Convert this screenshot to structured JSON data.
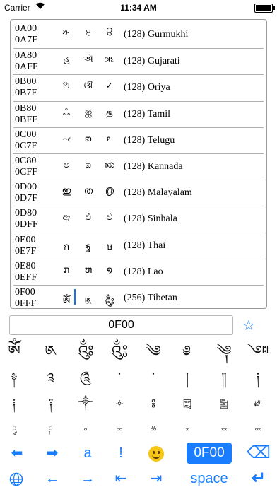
{
  "status_bar": {
    "carrier": "Carrier",
    "time": "11:34 AM"
  },
  "blocks": [
    {
      "start": "0A00",
      "end": "0A7F",
      "glyphs": [
        "ਅ",
        "ੲ",
        "ੳ"
      ],
      "count": "(128)",
      "name": "Gurmukhi"
    },
    {
      "start": "0A80",
      "end": "0AFF",
      "glyphs": [
        "હ",
        "ઍ",
        "ૠ"
      ],
      "count": "(128)",
      "name": "Gujarati"
    },
    {
      "start": "0B00",
      "end": "0B7F",
      "glyphs": [
        "ଅ",
        "ଔ",
        "✓"
      ],
      "count": "(128)",
      "name": "Oriya"
    },
    {
      "start": "0B80",
      "end": "0BFF",
      "glyphs": [
        "ஃ",
        "ஐ",
        "௲"
      ],
      "count": "(128)",
      "name": "Tamil"
    },
    {
      "start": "0C00",
      "end": "0C7F",
      "glyphs": [
        "ఁ",
        "ఐ",
        "ఽ"
      ],
      "count": "(128)",
      "name": "Telugu"
    },
    {
      "start": "0C80",
      "end": "0CFF",
      "glyphs": [
        "ಅ",
        "ಐ",
        "ಋ"
      ],
      "count": "(128)",
      "name": "Kannada"
    },
    {
      "start": "0D00",
      "end": "0D7F",
      "glyphs": [
        "ഇ",
        "ത",
        "൫"
      ],
      "count": "(128)",
      "name": "Malayalam"
    },
    {
      "start": "0D80",
      "end": "0DFF",
      "glyphs": [
        "ඇ",
        "ඵ",
        "ළු"
      ],
      "count": "(128)",
      "name": "Sinhala"
    },
    {
      "start": "0E00",
      "end": "0E7F",
      "glyphs": [
        "ก",
        "ฐ",
        "ษ"
      ],
      "count": "(128)",
      "name": "Thai"
    },
    {
      "start": "0E80",
      "end": "0EFF",
      "glyphs": [
        "ກ",
        "ຫ",
        "໑"
      ],
      "count": "(128)",
      "name": "Lao"
    },
    {
      "start": "0F00",
      "end": "0FFF",
      "glyphs": [
        "ༀ",
        "༁",
        "༂"
      ],
      "count": "(256)",
      "name": "Tibetan"
    }
  ],
  "search": {
    "value": "0F00"
  },
  "icons": {
    "favorite": "star-outline-icon",
    "globe": "globe-icon",
    "backspace": "backspace-icon",
    "return": "return-arrow-icon"
  },
  "glyph_grid": [
    [
      "ༀ",
      "༁",
      "༂",
      "༃",
      "༄",
      "༅",
      "༆",
      "༇"
    ],
    [
      "༈",
      "༉",
      "༊",
      "་",
      "༌",
      "།",
      "༎",
      "༏"
    ],
    [
      "༐",
      "༑",
      "༒",
      "༓",
      "༔",
      "༕",
      "༖",
      "༗"
    ],
    [
      "༘",
      "༙",
      "༚",
      "༛",
      "༜",
      "༝",
      "༞",
      "༟"
    ]
  ],
  "keyboard": {
    "row1": {
      "left": "⬅",
      "right": "➡",
      "letter": "a",
      "exclaim": "!",
      "code": "0F00",
      "backspace": "⌫"
    },
    "row2": {
      "left": "←",
      "right": "→",
      "dleft": "⇤",
      "dright": "⇥",
      "space": "space",
      "return": "↵"
    }
  },
  "colors": {
    "accent": "#1a7cff",
    "border": "#9a9a9a"
  }
}
